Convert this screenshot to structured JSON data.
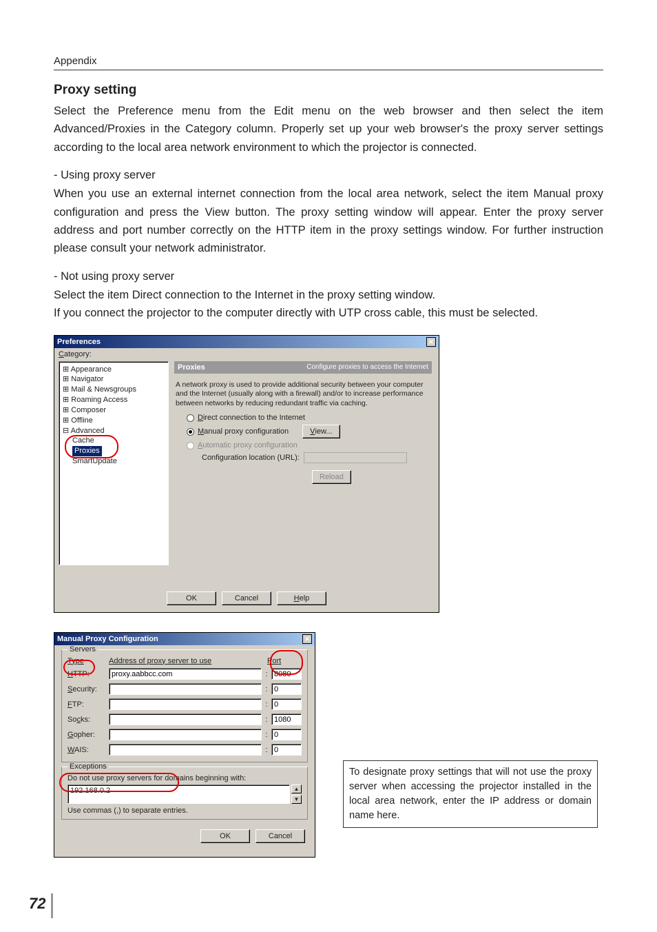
{
  "page": {
    "header": "Appendix",
    "number": "72"
  },
  "content": {
    "title": "Proxy setting",
    "intro": "Select the Preference menu from the Edit menu on the web browser and then select the item Advanced/Proxies in the Category column. Properly set up your web browser's the proxy server settings according to the local area network environment to which the projector is connected.",
    "sub1_title": "- Using proxy server",
    "sub1_body": "When you use an external internet connection from the local area network, select the item Manual proxy configuration and press the View button. The proxy setting window will appear. Enter the proxy server address and port number correctly on the HTTP item in the proxy settings window. For further instruction please consult your network administrator.",
    "sub2_title": "- Not using proxy server",
    "sub2_body_a": "Select the item Direct connection to the Internet in the proxy setting window.",
    "sub2_body_b": "If you connect the projector to the computer directly with UTP cross cable, this must be selected."
  },
  "prefs": {
    "title": "Preferences",
    "category_label": "Category:",
    "tree": {
      "appearance": "Appearance",
      "navigator": "Navigator",
      "mail": "Mail & Newsgroups",
      "roaming": "Roaming Access",
      "composer": "Composer",
      "offline": "Offline",
      "advanced": "Advanced",
      "cache": "Cache",
      "proxies": "Proxies",
      "smart": "SmartUpdate"
    },
    "pane_title": "Proxies",
    "pane_sub": "Configure proxies to access the Internet",
    "desc": "A network proxy is used to provide additional security between your computer and the Internet (usually along with a firewall) and/or to increase performance between networks by reducing redundant traffic via caching.",
    "r1": "Direct connection to the Internet",
    "r2": "Manual proxy configuration",
    "view_btn": "View...",
    "r3": "Automatic proxy configuration",
    "conf_label": "Configuration location (URL):",
    "reload_btn": "Reload",
    "ok": "OK",
    "cancel": "Cancel",
    "help": "Help"
  },
  "mpc": {
    "title": "Manual Proxy Configuration",
    "servers": "Servers",
    "type": "Type",
    "addr_head": "Address of proxy server to use",
    "port_head": "Port",
    "rows": {
      "http": {
        "label": "HTTP:",
        "addr": "proxy.aabbcc.com",
        "port": "8080"
      },
      "security": {
        "label": "Security:",
        "addr": "",
        "port": "0"
      },
      "ftp": {
        "label": "FTP:",
        "addr": "",
        "port": "0"
      },
      "socks": {
        "label": "Socks:",
        "addr": "",
        "port": "1080"
      },
      "gopher": {
        "label": "Gopher:",
        "addr": "",
        "port": "0"
      },
      "wais": {
        "label": "WAIS:",
        "addr": "",
        "port": "0"
      }
    },
    "exceptions": "Exceptions",
    "exc_label": "Do not use proxy servers for domains beginning with:",
    "exc_value": "192.168.0.2",
    "commas": "Use commas (,) to separate entries.",
    "ok": "OK",
    "cancel": "Cancel"
  },
  "callout": "To designate proxy settings that will not use the proxy server when accessing the projector installed in the local area network, enter the IP address or domain name here."
}
